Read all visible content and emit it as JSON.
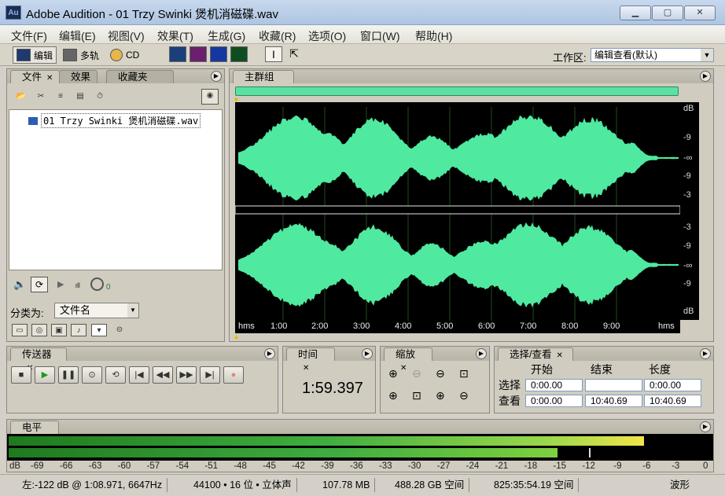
{
  "window": {
    "title": "Adobe Audition - 01 Trzy Swinki 煲机消磁碟.wav",
    "app_icon": "Au"
  },
  "menu": [
    "文件(F)",
    "编辑(E)",
    "视图(V)",
    "效果(T)",
    "生成(G)",
    "收藏(R)",
    "选项(O)",
    "窗口(W)",
    "帮助(H)"
  ],
  "toolbar": {
    "edit_label": "编辑",
    "multitrack_label": "多轨",
    "cd_label": "CD",
    "workspace_label": "工作区:",
    "workspace_value": "编辑查看(默认)"
  },
  "files_panel": {
    "tabs": [
      "文件",
      "效果",
      "收藏夹"
    ],
    "file_item": "01 Trzy Swinki 煲机消磁碟.wav",
    "sort_label": "分类为:",
    "sort_value": "文件名",
    "volume_value": "0"
  },
  "main_panel": {
    "tab": "主群组",
    "time_ticks": [
      "hms",
      "1:00",
      "2:00",
      "3:00",
      "4:00",
      "5:00",
      "6:00",
      "7:00",
      "8:00",
      "9:00",
      "hms"
    ],
    "db_ticks_top": [
      "dB",
      "-9",
      "-∞",
      "-9",
      "-3"
    ],
    "db_ticks_bottom": [
      "-3",
      "-9",
      "-∞",
      "-9",
      "dB"
    ]
  },
  "transport": {
    "tab": "传送器"
  },
  "time_panel": {
    "tab": "时间",
    "value": "1:59.397"
  },
  "zoom_panel": {
    "tab": "缩放"
  },
  "selection_panel": {
    "tab": "选择/查看",
    "headers": [
      "开始",
      "结束",
      "长度"
    ],
    "rows": [
      {
        "label": "选择",
        "start": "0:00.00",
        "end": "",
        "length": "0:00.00"
      },
      {
        "label": "查看",
        "start": "0:00.00",
        "end": "10:40.69",
        "length": "10:40.69"
      }
    ]
  },
  "level_panel": {
    "tab": "电平",
    "scale": [
      "dB",
      "-69",
      "-66",
      "-63",
      "-60",
      "-57",
      "-54",
      "-51",
      "-48",
      "-45",
      "-42",
      "-39",
      "-36",
      "-33",
      "-30",
      "-27",
      "-24",
      "-21",
      "-18",
      "-15",
      "-12",
      "-9",
      "-6",
      "-3",
      "0"
    ],
    "left_level_db": -6.3,
    "right_level_db": -15.3
  },
  "status": {
    "cursor": "左:-122 dB @   1:08.971, 6647Hz",
    "format": "44100 • 16 位 • 立体声",
    "size": "107.78 MB",
    "disk_free": "488.28 GB 空间",
    "time_free": "825:35:54.19 空间",
    "view_mode": "波形"
  },
  "colors": {
    "waveform": "#4fe9a0",
    "background": "#d4d0c8"
  }
}
